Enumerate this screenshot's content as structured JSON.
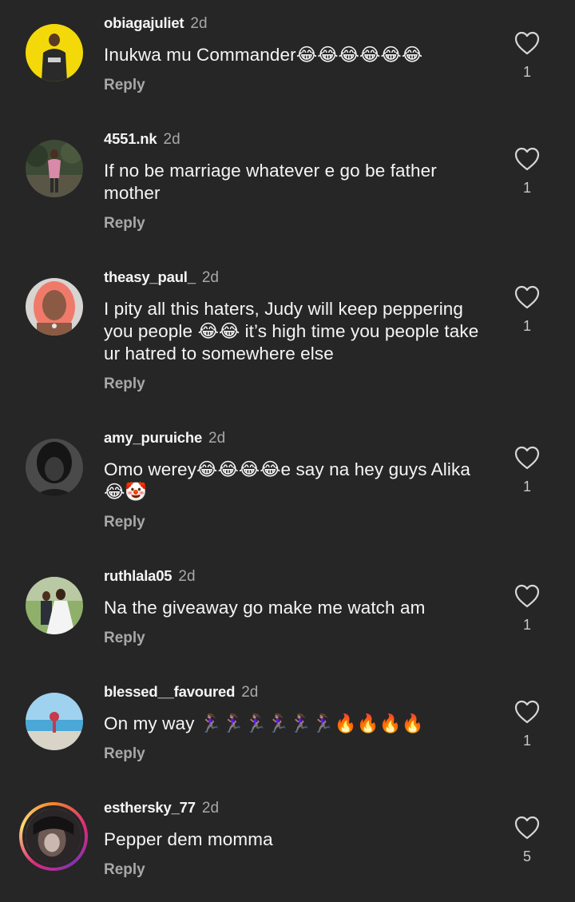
{
  "comments": [
    {
      "username": "obiagajuliet",
      "time": "2d",
      "text": "Inukwa mu Commander😂😂😂😂😂😂",
      "reply": "Reply",
      "likes": "1",
      "avatar": "avatar-yellow"
    },
    {
      "username": "4551.nk",
      "time": "2d",
      "text": "If no be marriage whatever e go be father mother",
      "reply": "Reply",
      "likes": "1",
      "avatar": "avatar-outdoor"
    },
    {
      "username": "theasy_paul_",
      "time": "2d",
      "text": "I pity all this haters, Judy will keep peppering you people 😂😂 it’s high time you people take ur hatred to somewhere else",
      "reply": "Reply",
      "likes": "1",
      "avatar": "avatar-pink-hair"
    },
    {
      "username": "amy_puruiche",
      "time": "2d",
      "text": "Omo werey😂😂😂😂e say na hey guys Alika 😂🤡",
      "reply": "Reply",
      "likes": "1",
      "avatar": "avatar-dark"
    },
    {
      "username": "ruthlala05",
      "time": "2d",
      "text": "Na the giveaway go make me watch am",
      "reply": "Reply",
      "likes": "1",
      "avatar": "avatar-wedding"
    },
    {
      "username": "blessed__favoured",
      "time": "2d",
      "text": "On my way 🏃🏽‍♀️🏃🏽‍♀️🏃🏽‍♀️🏃🏽‍♀️🏃🏽‍♀️🏃🏽‍♀️🔥🔥🔥🔥",
      "reply": "Reply",
      "likes": "1",
      "avatar": "avatar-beach"
    },
    {
      "username": "esthersky_77",
      "time": "2d",
      "text": "Pepper dem momma",
      "reply": "Reply",
      "likes": "5",
      "avatar": "avatar-story-ring"
    }
  ]
}
